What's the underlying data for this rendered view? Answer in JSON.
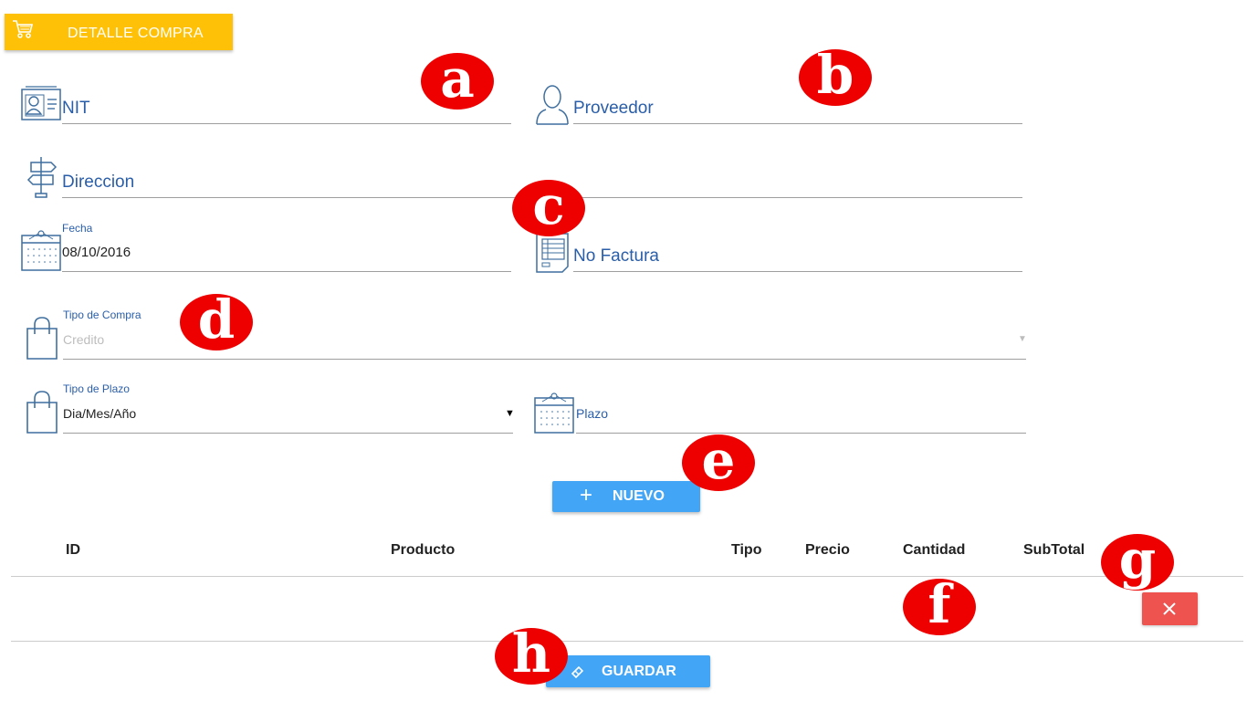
{
  "header": {
    "title": "DETALLE COMPRA",
    "icon": "cart-icon"
  },
  "form": {
    "nit": {
      "label": "NIT"
    },
    "proveedor": {
      "label": "Proveedor"
    },
    "direccion": {
      "label": "Direccion"
    },
    "fecha": {
      "label": "Fecha",
      "value": "08/10/2016"
    },
    "no_factura": {
      "label": "No Factura"
    },
    "tipo_compra": {
      "label": "Tipo de Compra",
      "value": "Credito"
    },
    "tipo_plazo": {
      "label": "Tipo de Plazo",
      "value": "Dia/Mes/Año"
    },
    "plazo": {
      "label": "Plazo"
    }
  },
  "buttons": {
    "nuevo": "NUEVO",
    "guardar": "GUARDAR"
  },
  "table": {
    "headers": [
      "ID",
      "Producto",
      "Tipo",
      "Precio",
      "Cantidad",
      "SubTotal"
    ]
  },
  "markers": [
    "a",
    "b",
    "c",
    "d",
    "e",
    "f",
    "g",
    "h"
  ],
  "colors": {
    "header": "#ffc107",
    "primary_blue": "#42a5f5",
    "label_blue": "#2a5ea8",
    "delete_red": "#ef5350",
    "marker_red": "#ee0000"
  }
}
